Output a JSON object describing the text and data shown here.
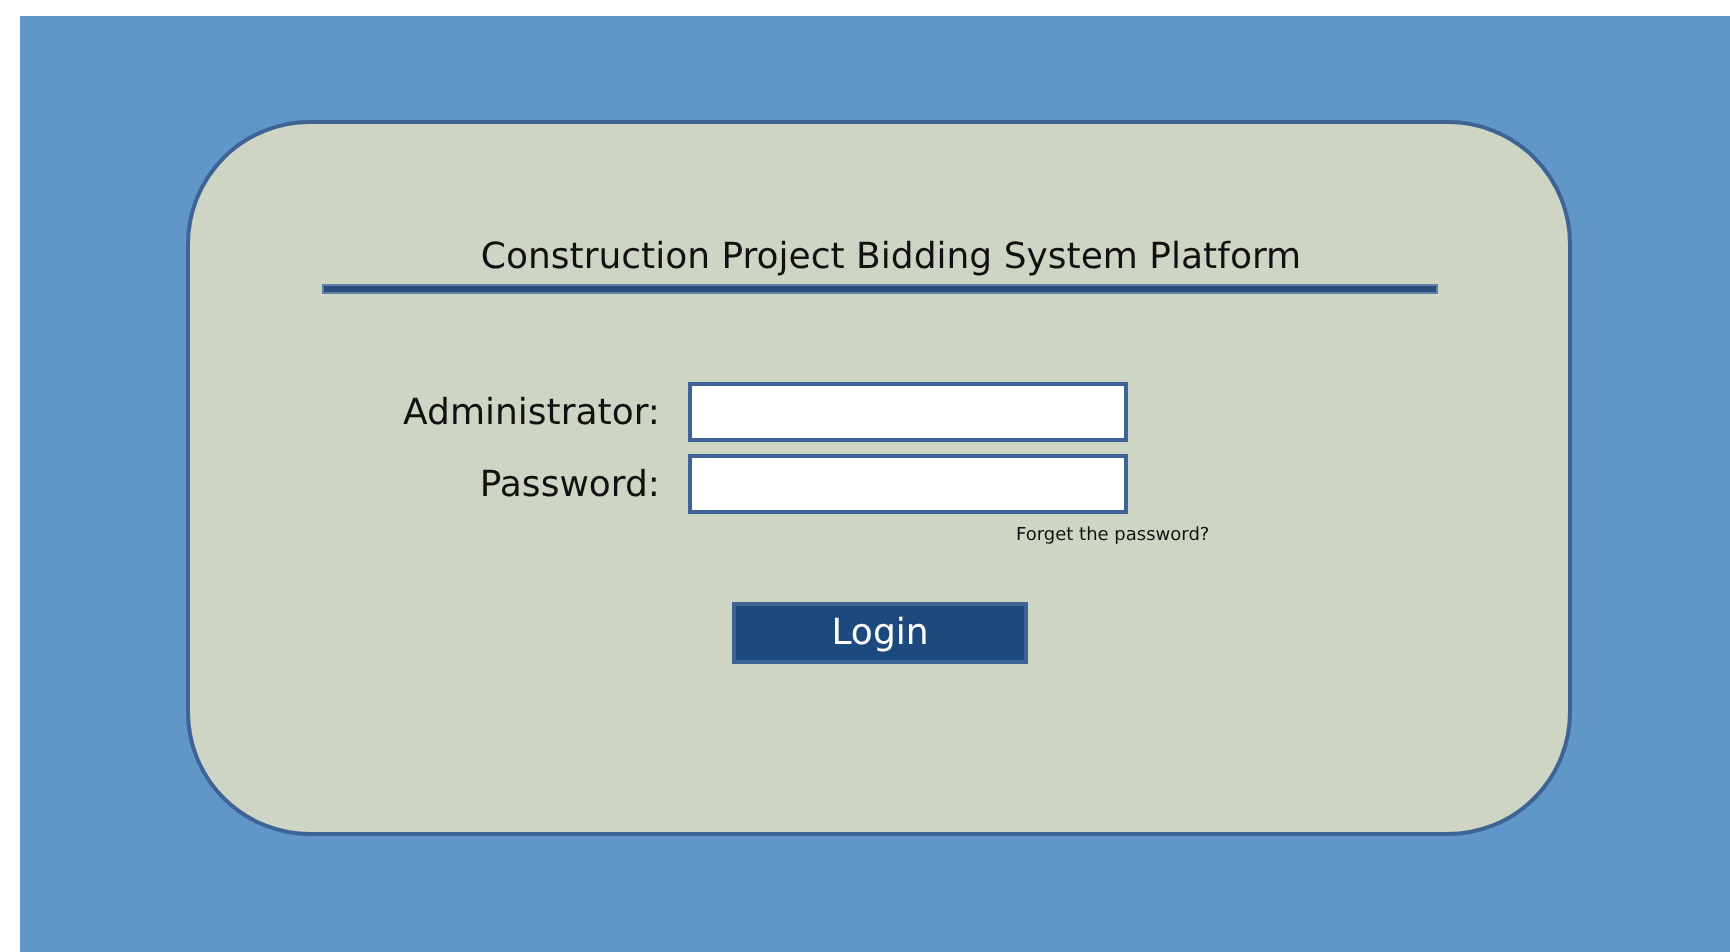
{
  "title": "Construction Project Bidding System Platform",
  "fields": [
    {
      "label": "Administrator:"
    },
    {
      "label": "Password:"
    }
  ],
  "forgot_link": "Forget the password?",
  "login_button": "Login"
}
